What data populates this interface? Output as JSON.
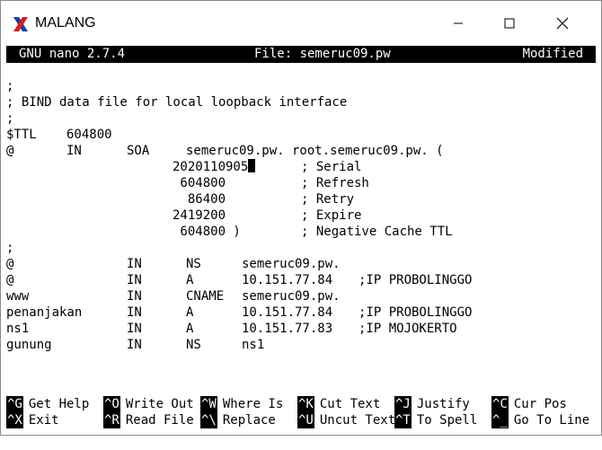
{
  "window": {
    "title": "MALANG",
    "minimize_glyph": "—",
    "maximize_glyph": "☐",
    "close_glyph": "✕"
  },
  "nano": {
    "version": "GNU nano 2.7.4",
    "file": "File: semeruc09.pw",
    "status": "Modified"
  },
  "editor": {
    "comment1": ";",
    "comment2": "; BIND data file for local loopback interface",
    "comment3": ";",
    "ttl": {
      "c1": "$TTL",
      "c2": "604800"
    },
    "soa": {
      "c1": "@",
      "c2": "IN",
      "c3": "SOA",
      "c4": "semeruc09.pw. root.semeruc09.pw. ("
    },
    "serial": {
      "value": "2020110905",
      "comment": "; Serial"
    },
    "refresh": {
      "value": " 604800",
      "comment": "; Refresh"
    },
    "retry": {
      "value": "  86400",
      "comment": "; Retry"
    },
    "expire": {
      "value": "2419200",
      "comment": "; Expire"
    },
    "negcache": {
      "value": " 604800 )",
      "comment": "; Negative Cache TTL"
    },
    "comment4": ";",
    "records": [
      {
        "name": "@",
        "class": "IN",
        "type": "NS",
        "data": "semeruc09.pw.",
        "comment": ""
      },
      {
        "name": "@",
        "class": "IN",
        "type": "A",
        "data": "10.151.77.84",
        "comment": ";IP PROBOLINGGO"
      },
      {
        "name": "www",
        "class": "IN",
        "type": "CNAME",
        "data": "semeruc09.pw.",
        "comment": ""
      },
      {
        "name": "penanjakan",
        "class": "IN",
        "type": "A",
        "data": "10.151.77.84",
        "comment": ";IP PROBOLINGGO"
      },
      {
        "name": "ns1",
        "class": "IN",
        "type": "A",
        "data": "10.151.77.83",
        "comment": ";IP MOJOKERTO"
      },
      {
        "name": "gunung",
        "class": "IN",
        "type": "NS",
        "data": "ns1",
        "comment": ""
      }
    ]
  },
  "shortcuts": [
    {
      "key": "^G",
      "label": "Get Help"
    },
    {
      "key": "^O",
      "label": "Write Out"
    },
    {
      "key": "^W",
      "label": "Where Is"
    },
    {
      "key": "^K",
      "label": "Cut Text"
    },
    {
      "key": "^J",
      "label": "Justify"
    },
    {
      "key": "^C",
      "label": "Cur Pos"
    },
    {
      "key": "^X",
      "label": "Exit"
    },
    {
      "key": "^R",
      "label": "Read File"
    },
    {
      "key": "^\\",
      "label": "Replace"
    },
    {
      "key": "^U",
      "label": "Uncut Text"
    },
    {
      "key": "^T",
      "label": "To Spell"
    },
    {
      "key": "^_",
      "label": "Go To Line"
    }
  ]
}
